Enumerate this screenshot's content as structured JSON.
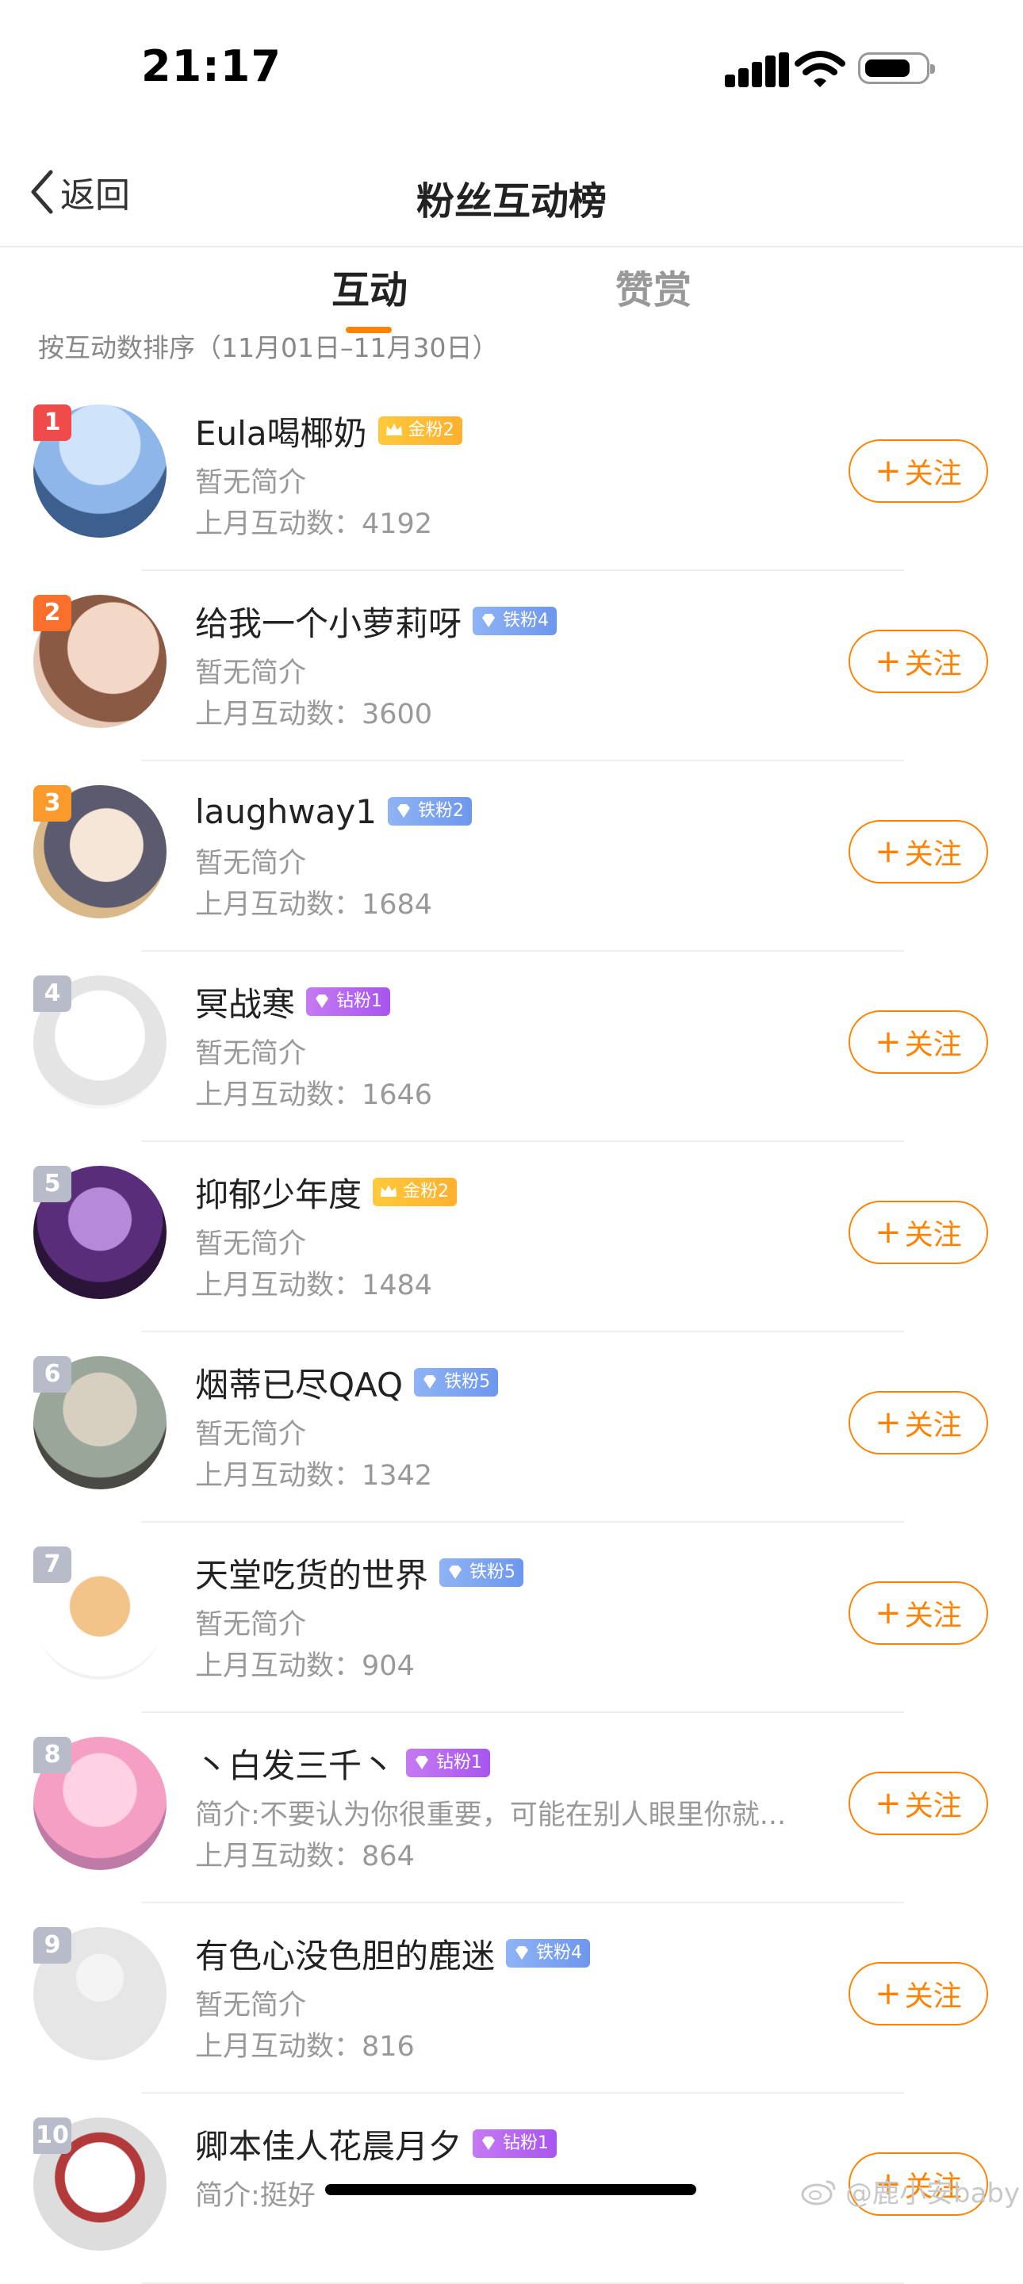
{
  "status_bar": {
    "time": "21:17"
  },
  "nav": {
    "back_label": "返回",
    "title": "粉丝互动榜"
  },
  "tabs": [
    {
      "label": "互动",
      "active": true
    },
    {
      "label": "赞赏",
      "active": false
    }
  ],
  "sort_text": "按互动数排序（11月01日–11月30日）",
  "follow_label": "关注",
  "colors": {
    "accent": "#ff8200",
    "gold": "#ffb02e",
    "iron": "#6d97ee",
    "diamond": "#a855f0"
  },
  "fans": [
    {
      "rank": "1",
      "name": "Eula喝椰奶",
      "badge": "金粉2",
      "badge_type": "gold",
      "bio": "暂无简介",
      "count": "上月互动数：4192",
      "rank_color": "#f04b4b"
    },
    {
      "rank": "2",
      "name": "给我一个小萝莉呀",
      "badge": "铁粉4",
      "badge_type": "iron",
      "bio": "暂无简介",
      "count": "上月互动数：3600",
      "rank_color": "#fb6f2c"
    },
    {
      "rank": "3",
      "name": "laughway1",
      "badge": "铁粉2",
      "badge_type": "iron",
      "bio": "暂无简介",
      "count": "上月互动数：1684",
      "rank_color": "#fb9a2c"
    },
    {
      "rank": "4",
      "name": "冥战寒",
      "badge": "钻粉1",
      "badge_type": "diamond",
      "bio": "暂无简介",
      "count": "上月互动数：1646",
      "rank_color": "#b7bcc8"
    },
    {
      "rank": "5",
      "name": "抑郁少年度",
      "badge": "金粉2",
      "badge_type": "gold",
      "bio": "暂无简介",
      "count": "上月互动数：1484",
      "rank_color": "#b7bcc8"
    },
    {
      "rank": "6",
      "name": "烟蒂已尽QAQ",
      "badge": "铁粉5",
      "badge_type": "iron",
      "bio": "暂无简介",
      "count": "上月互动数：1342",
      "rank_color": "#b7bcc8"
    },
    {
      "rank": "7",
      "name": "天堂吃货的世界",
      "badge": "铁粉5",
      "badge_type": "iron",
      "bio": "暂无简介",
      "count": "上月互动数：904",
      "rank_color": "#b7bcc8"
    },
    {
      "rank": "8",
      "name": "丶白发三千丶",
      "badge": "钻粉1",
      "badge_type": "diamond",
      "bio": "简介:不要认为你很重要，可能在别人眼里你就...",
      "count": "上月互动数：864",
      "rank_color": "#b7bcc8"
    },
    {
      "rank": "9",
      "name": "有色心没色胆的鹿迷",
      "badge": "铁粉4",
      "badge_type": "iron",
      "bio": "暂无简介",
      "count": "上月互动数：816",
      "rank_color": "#b7bcc8"
    },
    {
      "rank": "10",
      "name": "卿本佳人花晨月夕",
      "badge": "钻粉1",
      "badge_type": "diamond",
      "bio": "简介:挺好",
      "count": "",
      "rank_color": "#b7bcc8"
    }
  ],
  "watermark": "@鹿小安baby"
}
